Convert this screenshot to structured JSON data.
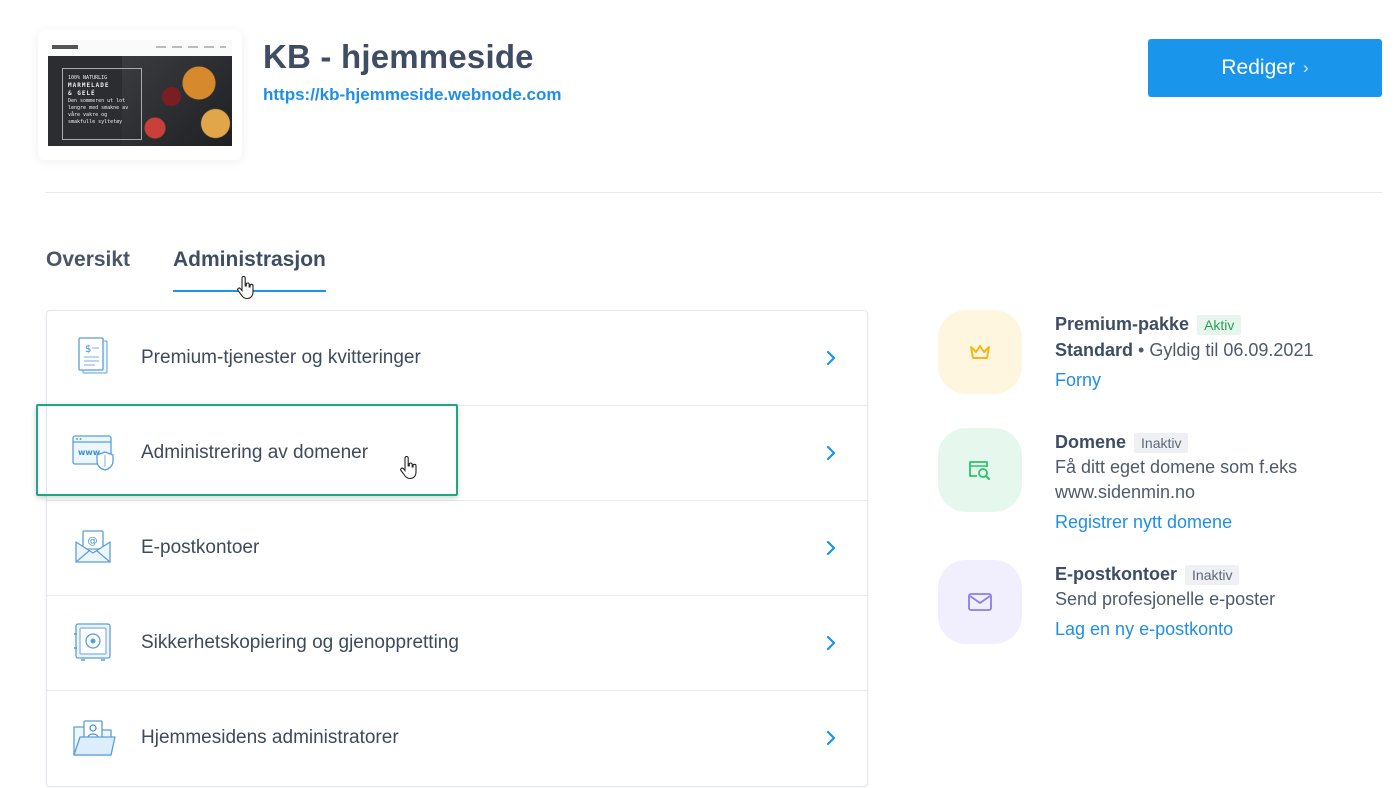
{
  "site": {
    "title": "KB - hjemmeside",
    "url": "https://kb-hjemmeside.webnode.com",
    "edit_label": "Rediger",
    "edit_chevron": "›",
    "thumbnail": {
      "line1": "100% NATURLIG",
      "line2": "MARMELADE",
      "line3": "& GELÉ",
      "body": "Den sommeren ut lot lengre med smakne av våre vakre og smakfulle syltetøy"
    }
  },
  "tabs": [
    {
      "label": "Oversikt",
      "active": false
    },
    {
      "label": "Administrasjon",
      "active": true
    }
  ],
  "admin_items": [
    {
      "label": "Premium-tjenester og kvitteringer",
      "icon": "receipt-icon"
    },
    {
      "label": "Administrering av domener",
      "icon": "domain-shield-icon"
    },
    {
      "label": "E-postkontoer",
      "icon": "email-envelope-icon"
    },
    {
      "label": "Sikkerhetskopiering og gjenoppretting",
      "icon": "safe-icon"
    },
    {
      "label": "Hjemmesidens administratorer",
      "icon": "admin-folder-icon"
    }
  ],
  "services": [
    {
      "title": "Premium-pakke",
      "badge": "Aktiv",
      "plan": "Standard",
      "separator": "•",
      "validity": "Gyldig til 06.09.2021",
      "link": "Forny",
      "icon": "crown-icon",
      "color": "#f5b51b"
    },
    {
      "title": "Domene",
      "badge": "Inaktiv",
      "line1": "Få ditt eget domene som f.eks",
      "line2": "www.sidenmin.no",
      "link": "Registrer nytt domene",
      "icon": "domain-search-icon",
      "color": "#2bc26b"
    },
    {
      "title": "E-postkontoer",
      "badge": "Inaktiv",
      "line1": "Send profesjonelle e-poster",
      "link": "Lag en ny e-postkonto",
      "icon": "mail-icon",
      "color": "#8b7cf0"
    }
  ],
  "colors": {
    "accent": "#1a95ec",
    "highlight": "#1ba883",
    "title": "#3e4d63"
  }
}
